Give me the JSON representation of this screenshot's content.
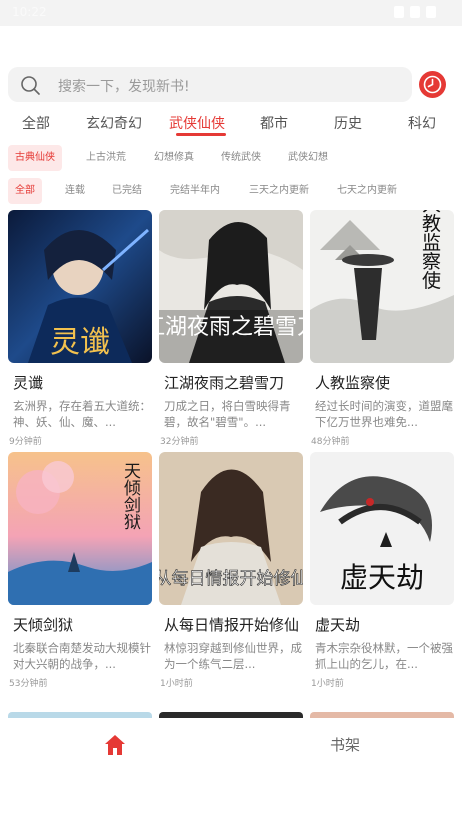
{
  "status_bar": {
    "time": "10:22"
  },
  "search": {
    "placeholder": "搜索一下，发现新书!"
  },
  "categories": [
    "全部",
    "玄幻奇幻",
    "武侠仙侠",
    "都市",
    "历史",
    "科幻"
  ],
  "active_category": "武侠仙侠",
  "subcategories": [
    "古典仙侠",
    "上古洪荒",
    "幻想修真",
    "传统武侠",
    "武侠幻想"
  ],
  "active_subcategory": "古典仙侠",
  "filters": [
    "全部",
    "连载",
    "已完结",
    "完结半年内",
    "三天之内更新",
    "七天之内更新"
  ],
  "active_filter": "全部",
  "books": [
    {
      "title": "灵谶",
      "desc": "玄洲界，存在着五大道统：神、妖、仙、魔、...",
      "time": "9分钟前",
      "cover_text": "灵谶"
    },
    {
      "title": "江湖夜雨之碧雪刀",
      "desc": "刀成之日，将白雪映得青碧，故名\"碧雪\"。...",
      "time": "32分钟前",
      "cover_text": "江湖夜雨之碧雪刀"
    },
    {
      "title": "人教监察使",
      "desc": "经过长时间的演变，道盟麾下亿万世界也难免...",
      "time": "48分钟前",
      "cover_text": "人教监察使"
    },
    {
      "title": "天倾剑狱",
      "desc": "北秦联合南楚发动大规模针对大兴朝的战争，...",
      "time": "53分钟前",
      "cover_text": "天倾剑狱"
    },
    {
      "title": "从每日情报开始修仙",
      "desc": "林惊羽穿越到修仙世界，成为一个练气二层...",
      "time": "1小时前",
      "cover_text": "从每日情报开始修仙"
    },
    {
      "title": "虚天劫",
      "desc": "青木宗杂役林默，一个被强抓上山的乞儿，在...",
      "time": "1小时前",
      "cover_text": "虚天劫"
    }
  ],
  "bottom_nav": {
    "home_icon": "home-icon",
    "shelf_label": "书架"
  },
  "colors": {
    "accent": "#e53935",
    "chip_bg": "#fde8e8"
  }
}
